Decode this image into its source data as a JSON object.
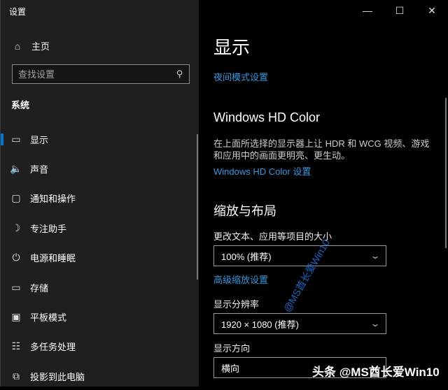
{
  "window": {
    "title": "设置",
    "minimize": "—",
    "maximize": "☐",
    "close": "✕"
  },
  "sidebar": {
    "home": {
      "icon": "home-icon",
      "label": "主页"
    },
    "search": {
      "placeholder": "查找设置",
      "icon": "search-icon"
    },
    "section": "系统",
    "items": [
      {
        "label": "显示",
        "icon": "monitor-icon",
        "glyph": "▭",
        "active": true
      },
      {
        "label": "声音",
        "icon": "speaker-icon",
        "glyph": "🔈"
      },
      {
        "label": "通知和操作",
        "icon": "notification-icon",
        "glyph": "▢"
      },
      {
        "label": "专注助手",
        "icon": "moon-icon",
        "glyph": "☽"
      },
      {
        "label": "电源和睡眠",
        "icon": "power-icon",
        "glyph": "⏻"
      },
      {
        "label": "存储",
        "icon": "storage-icon",
        "glyph": "▭"
      },
      {
        "label": "平板模式",
        "icon": "tablet-icon",
        "glyph": "▣"
      },
      {
        "label": "多任务处理",
        "icon": "multitask-icon",
        "glyph": "☷"
      },
      {
        "label": "投影到此电脑",
        "icon": "project-icon",
        "glyph": "⧉"
      }
    ]
  },
  "main": {
    "title": "显示",
    "night_link": "夜间模式设置",
    "hd_heading": "Windows HD Color",
    "hd_desc": "在上面所选择的显示器上让 HDR 和 WCG 视频、游戏和应用中的画面更明亮、更生动。",
    "hd_link": "Windows HD Color 设置",
    "scale_heading": "缩放与布局",
    "scale_label": "更改文本、应用等项目的大小",
    "scale_value": "100% (推荐)",
    "advanced_link": "高级缩放设置",
    "resolution_label": "显示分辨率",
    "resolution_value": "1920 × 1080 (推荐)",
    "orientation_label": "显示方向",
    "orientation_value": "横向"
  },
  "watermark": {
    "diagonal": "@MS酋长爱Win10",
    "bottom": "头条 @MS酋长爱Win10"
  }
}
